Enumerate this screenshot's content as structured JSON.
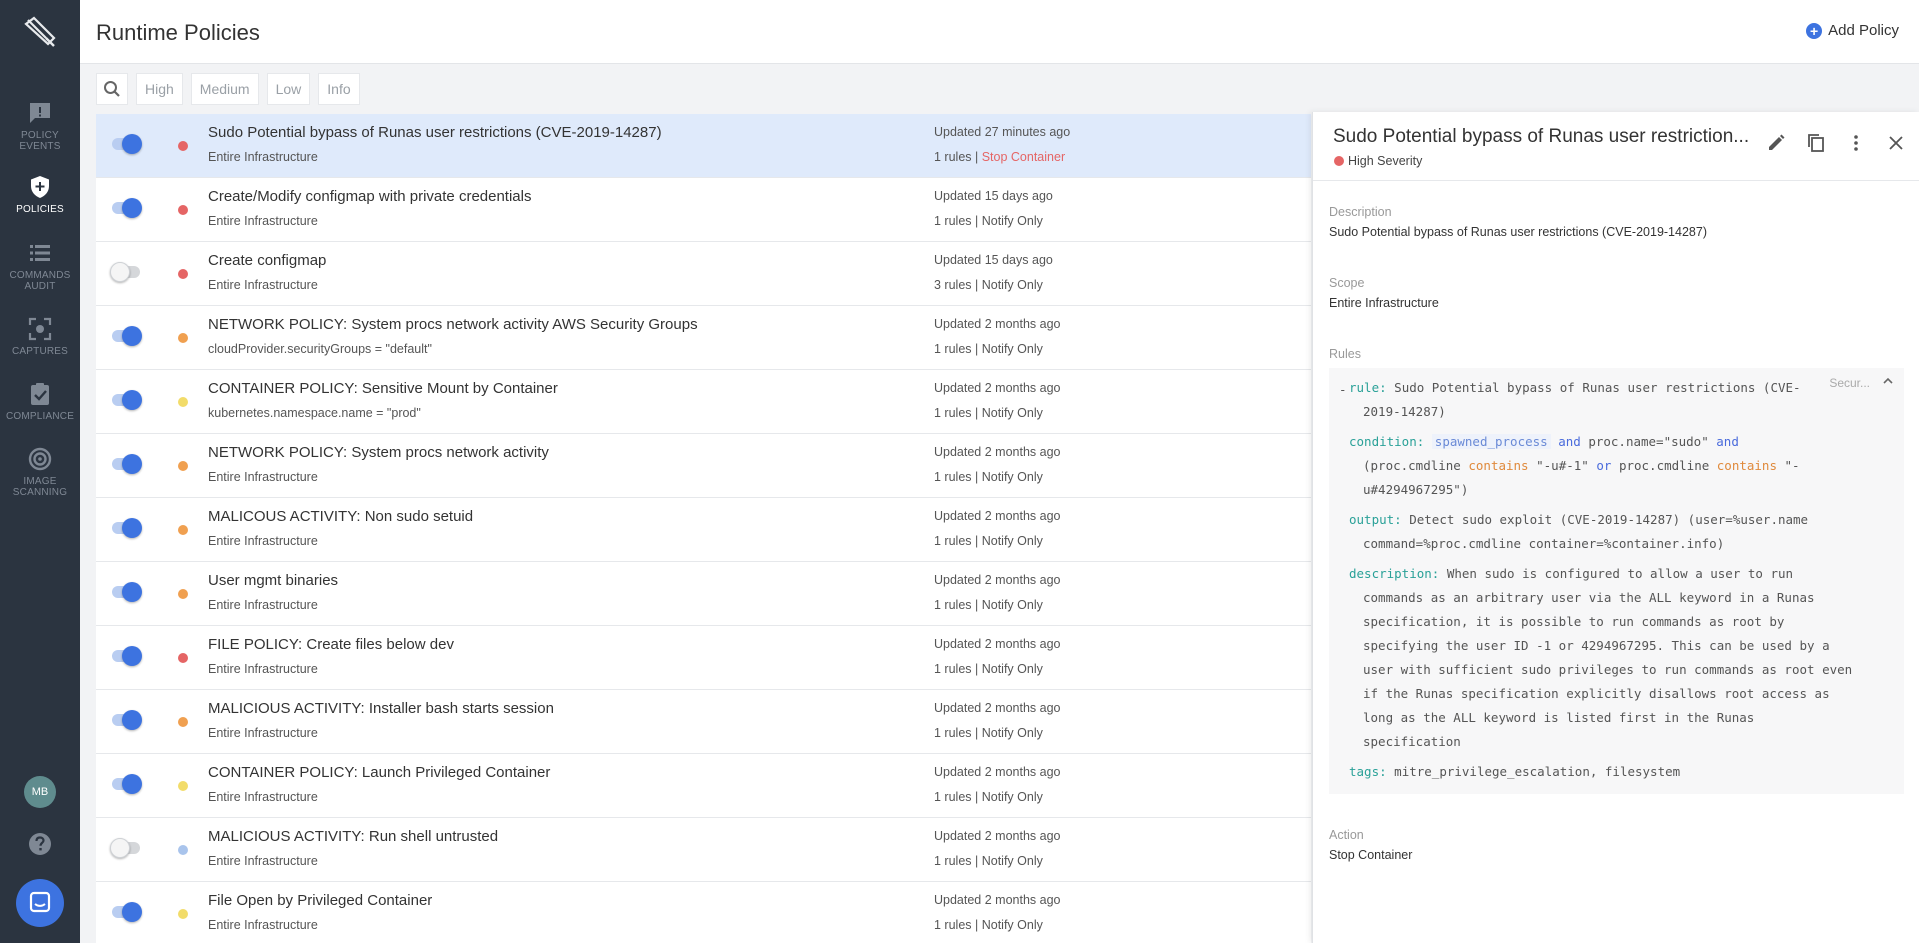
{
  "sidebar": {
    "items": [
      {
        "key": "policy-events",
        "label_line1": "POLICY",
        "label_line2": "EVENTS",
        "icon": "alert-message-icon",
        "active": false
      },
      {
        "key": "policies",
        "label_line1": "POLICIES",
        "label_line2": "",
        "icon": "shield-plus-icon",
        "active": true
      },
      {
        "key": "commands-audit",
        "label_line1": "COMMANDS",
        "label_line2": "AUDIT",
        "icon": "list-icon",
        "active": false
      },
      {
        "key": "captures",
        "label_line1": "CAPTURES",
        "label_line2": "",
        "icon": "capture-frame-icon",
        "active": false
      },
      {
        "key": "compliance",
        "label_line1": "COMPLIANCE",
        "label_line2": "",
        "icon": "clipboard-check-icon",
        "active": false
      },
      {
        "key": "image-scanning",
        "label_line1": "IMAGE",
        "label_line2": "SCANNING",
        "icon": "target-icon",
        "active": false
      }
    ],
    "avatar_initials": "MB"
  },
  "header": {
    "title": "Runtime Policies",
    "add_label": "Add Policy"
  },
  "filters": [
    "High",
    "Medium",
    "Low",
    "Info"
  ],
  "colors": {
    "high": "#e56565",
    "medium": "#f0a050",
    "low": "#f2dc6a",
    "info": "#a9c4ec",
    "accent": "#3d73e0"
  },
  "policies": [
    {
      "name": "Sudo Potential bypass of Runas user restrictions (CVE-2019-14287)",
      "scope": "Entire Infrastructure",
      "updated": "Updated 27 minutes ago",
      "rules": "1 rules | ",
      "action": "Stop Container",
      "severity": "high",
      "enabled": true,
      "selected": true
    },
    {
      "name": "Create/Modify configmap with private credentials",
      "scope": "Entire Infrastructure",
      "updated": "Updated 15 days ago",
      "rules": "1 rules | ",
      "action": "Notify Only",
      "severity": "high",
      "enabled": true,
      "selected": false
    },
    {
      "name": "Create configmap",
      "scope": "Entire Infrastructure",
      "updated": "Updated 15 days ago",
      "rules": "3 rules | ",
      "action": "Notify Only",
      "severity": "high",
      "enabled": false,
      "selected": false
    },
    {
      "name": "NETWORK POLICY: System procs network activity AWS Security Groups",
      "scope": "cloudProvider.securityGroups = \"default\"",
      "updated": "Updated 2 months ago",
      "rules": "1 rules | ",
      "action": "Notify Only",
      "severity": "medium",
      "enabled": true,
      "selected": false
    },
    {
      "name": "CONTAINER POLICY: Sensitive Mount by Container",
      "scope": "kubernetes.namespace.name = \"prod\"",
      "updated": "Updated 2 months ago",
      "rules": "1 rules | ",
      "action": "Notify Only",
      "severity": "low",
      "enabled": true,
      "selected": false
    },
    {
      "name": "NETWORK POLICY: System procs network activity",
      "scope": "Entire Infrastructure",
      "updated": "Updated 2 months ago",
      "rules": "1 rules | ",
      "action": "Notify Only",
      "severity": "medium",
      "enabled": true,
      "selected": false
    },
    {
      "name": "MALICOUS ACTIVITY: Non sudo setuid",
      "scope": "Entire Infrastructure",
      "updated": "Updated 2 months ago",
      "rules": "1 rules | ",
      "action": "Notify Only",
      "severity": "medium",
      "enabled": true,
      "selected": false
    },
    {
      "name": "User mgmt binaries",
      "scope": "Entire Infrastructure",
      "updated": "Updated 2 months ago",
      "rules": "1 rules | ",
      "action": "Notify Only",
      "severity": "medium",
      "enabled": true,
      "selected": false
    },
    {
      "name": "FILE POLICY: Create files below dev",
      "scope": "Entire Infrastructure",
      "updated": "Updated 2 months ago",
      "rules": "1 rules | ",
      "action": "Notify Only",
      "severity": "high",
      "enabled": true,
      "selected": false
    },
    {
      "name": "MALICIOUS ACTIVITY: Installer bash starts session",
      "scope": "Entire Infrastructure",
      "updated": "Updated 2 months ago",
      "rules": "1 rules | ",
      "action": "Notify Only",
      "severity": "medium",
      "enabled": true,
      "selected": false
    },
    {
      "name": "CONTAINER POLICY: Launch Privileged Container",
      "scope": "Entire Infrastructure",
      "updated": "Updated 2 months ago",
      "rules": "1 rules | ",
      "action": "Notify Only",
      "severity": "low",
      "enabled": true,
      "selected": false
    },
    {
      "name": "MALICIOUS ACTIVITY: Run shell untrusted",
      "scope": "Entire Infrastructure",
      "updated": "Updated 2 months ago",
      "rules": "1 rules | ",
      "action": "Notify Only",
      "severity": "info",
      "enabled": false,
      "selected": false
    },
    {
      "name": "File Open by Privileged Container",
      "scope": "Entire Infrastructure",
      "updated": "Updated 2 months ago",
      "rules": "1 rules | ",
      "action": "Notify Only",
      "severity": "low",
      "enabled": true,
      "selected": false
    }
  ],
  "detail": {
    "title": "Sudo Potential bypass of Runas user restriction...",
    "severity_label": "High Severity",
    "description_label": "Description",
    "description": "Sudo Potential bypass of Runas user restrictions (CVE-2019-14287)",
    "scope_label": "Scope",
    "scope": "Entire Infrastructure",
    "rules_label": "Rules",
    "action_label": "Action",
    "action": "Stop Container",
    "rule_tag": "Secur...",
    "rule": {
      "rule_key": "rule:",
      "rule_line1": "Sudo Potential bypass of Runas user restrictions (CVE-",
      "rule_line2": "2019-14287)",
      "condition_key": "condition:",
      "cond_macro": "spawned_process",
      "cond_and1": "and",
      "cond_proc_name": "proc.name=\"sudo\"",
      "cond_and2": "and",
      "cond_open": "(proc.cmdline",
      "cond_contains1": "contains",
      "cond_val1": "\"-u#-1\"",
      "cond_or": "or",
      "cond_cmdline2": "proc.cmdline",
      "cond_contains2": "contains",
      "cond_val2a": "\"-",
      "cond_val2b": "u#4294967295\"",
      "cond_close": ")",
      "output_key": "output:",
      "output_line1": "Detect sudo exploit (CVE-2019-14287) (user=%user.name",
      "output_line2": "command=%proc.cmdline container=%container.info)",
      "description_key": "description:",
      "desc_lines": [
        "When sudo is configured to allow a user to run",
        "commands as an arbitrary user via the ALL keyword in a Runas",
        "specification, it is possible to run commands as root by",
        "specifying the user ID -1 or 4294967295. This can be used by a",
        "user with sufficient sudo privileges to run commands as root even",
        "if the Runas specification explicitly disallows root access as",
        "long as the ALL keyword is listed first in the Runas",
        "specification"
      ],
      "tags_key": "tags:",
      "tags": "mitre_privilege_escalation, filesystem"
    }
  }
}
